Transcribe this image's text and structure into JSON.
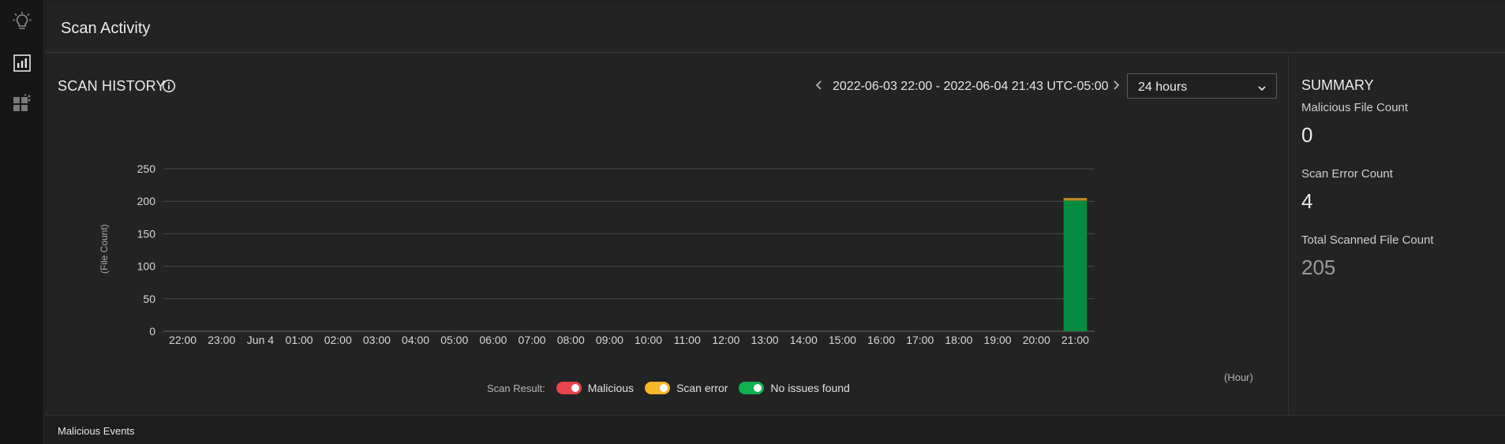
{
  "nav": {
    "items": [
      {
        "icon": "lightbulb-icon"
      },
      {
        "icon": "report-chart-icon",
        "active": true
      },
      {
        "icon": "dashboard-tiles-icon"
      }
    ]
  },
  "header": {
    "title": "Scan Activity"
  },
  "scan_history": {
    "title": "SCAN HISTORY",
    "range": "2022-06-03 22:00 - 2022-06-04 21:43 UTC-05:00",
    "period": "24 hours"
  },
  "chart_data": {
    "type": "bar",
    "stacked": true,
    "categories": [
      "22:00",
      "23:00",
      "Jun 4",
      "01:00",
      "02:00",
      "03:00",
      "04:00",
      "05:00",
      "06:00",
      "07:00",
      "08:00",
      "09:00",
      "10:00",
      "11:00",
      "12:00",
      "13:00",
      "14:00",
      "15:00",
      "16:00",
      "17:00",
      "18:00",
      "19:00",
      "20:00",
      "21:00"
    ],
    "series": [
      {
        "name": "No issues found",
        "color": "#038c3f",
        "values": [
          0,
          0,
          0,
          0,
          0,
          0,
          0,
          0,
          0,
          0,
          0,
          0,
          0,
          0,
          0,
          0,
          0,
          0,
          0,
          0,
          0,
          0,
          0,
          201
        ]
      },
      {
        "name": "Scan error",
        "color": "#c08a25",
        "values": [
          0,
          0,
          0,
          0,
          0,
          0,
          0,
          0,
          0,
          0,
          0,
          0,
          0,
          0,
          0,
          0,
          0,
          0,
          0,
          0,
          0,
          0,
          0,
          4
        ]
      },
      {
        "name": "Malicious",
        "color": "#e8444e",
        "values": [
          0,
          0,
          0,
          0,
          0,
          0,
          0,
          0,
          0,
          0,
          0,
          0,
          0,
          0,
          0,
          0,
          0,
          0,
          0,
          0,
          0,
          0,
          0,
          0
        ]
      }
    ],
    "yticks": [
      0,
      50,
      100,
      150,
      200,
      250
    ],
    "ylim": [
      0,
      250
    ],
    "ylabel": "(File Count)",
    "xlabel": "(Hour)",
    "grid": true,
    "legend_caption": "Scan Result:",
    "legend": [
      {
        "label": "Malicious",
        "color": "#e8444e"
      },
      {
        "label": "Scan error",
        "color": "#f6b72a"
      },
      {
        "label": "No issues found",
        "color": "#10b24f"
      }
    ]
  },
  "summary": {
    "title": "SUMMARY",
    "malicious_label": "Malicious File Count",
    "malicious_value": "0",
    "error_label": "Scan Error Count",
    "error_value": "4",
    "total_label": "Total Scanned File Count",
    "total_value": "205"
  },
  "footer": {
    "title": "Malicious Events"
  }
}
